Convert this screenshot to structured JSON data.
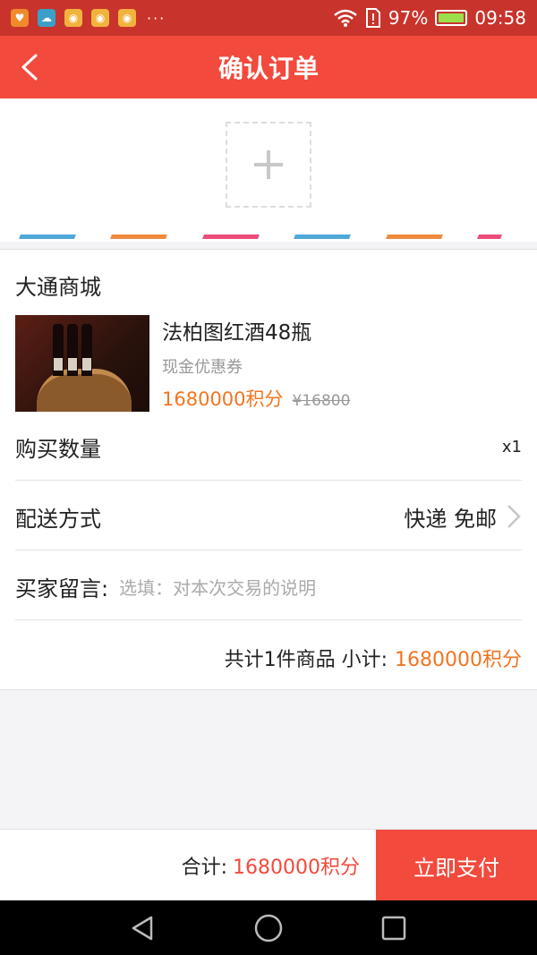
{
  "statusbar": {
    "battery_percent": "97%",
    "time": "09:58",
    "overflow": "···",
    "battery_level": 0.97
  },
  "header": {
    "title": "确认订单"
  },
  "address": {
    "add_icon": "plus-icon"
  },
  "order": {
    "shop_name": "大通商城",
    "product": {
      "name": "法柏图红酒48瓶",
      "coupon": "现金优惠券",
      "points_price": "1680000积分",
      "original_price": "¥16800"
    },
    "quantity": {
      "label": "购买数量",
      "value": "x1"
    },
    "shipping": {
      "label": "配送方式",
      "value": "快递 免邮"
    },
    "message": {
      "label": "买家留言:",
      "placeholder": "选填：对本次交易的说明"
    },
    "summary": {
      "label": "共计1件商品 小计:",
      "value": "1680000积分"
    }
  },
  "footer": {
    "total_label": "合计:",
    "total_value": "1680000积分",
    "pay_button": "立即支付"
  },
  "colors": {
    "brand_red": "#f24a3c",
    "points_orange": "#f27420",
    "stripe_blue": "#4fa8d8",
    "stripe_orange": "#ef8a3c",
    "stripe_pink": "#ea4d7a"
  }
}
